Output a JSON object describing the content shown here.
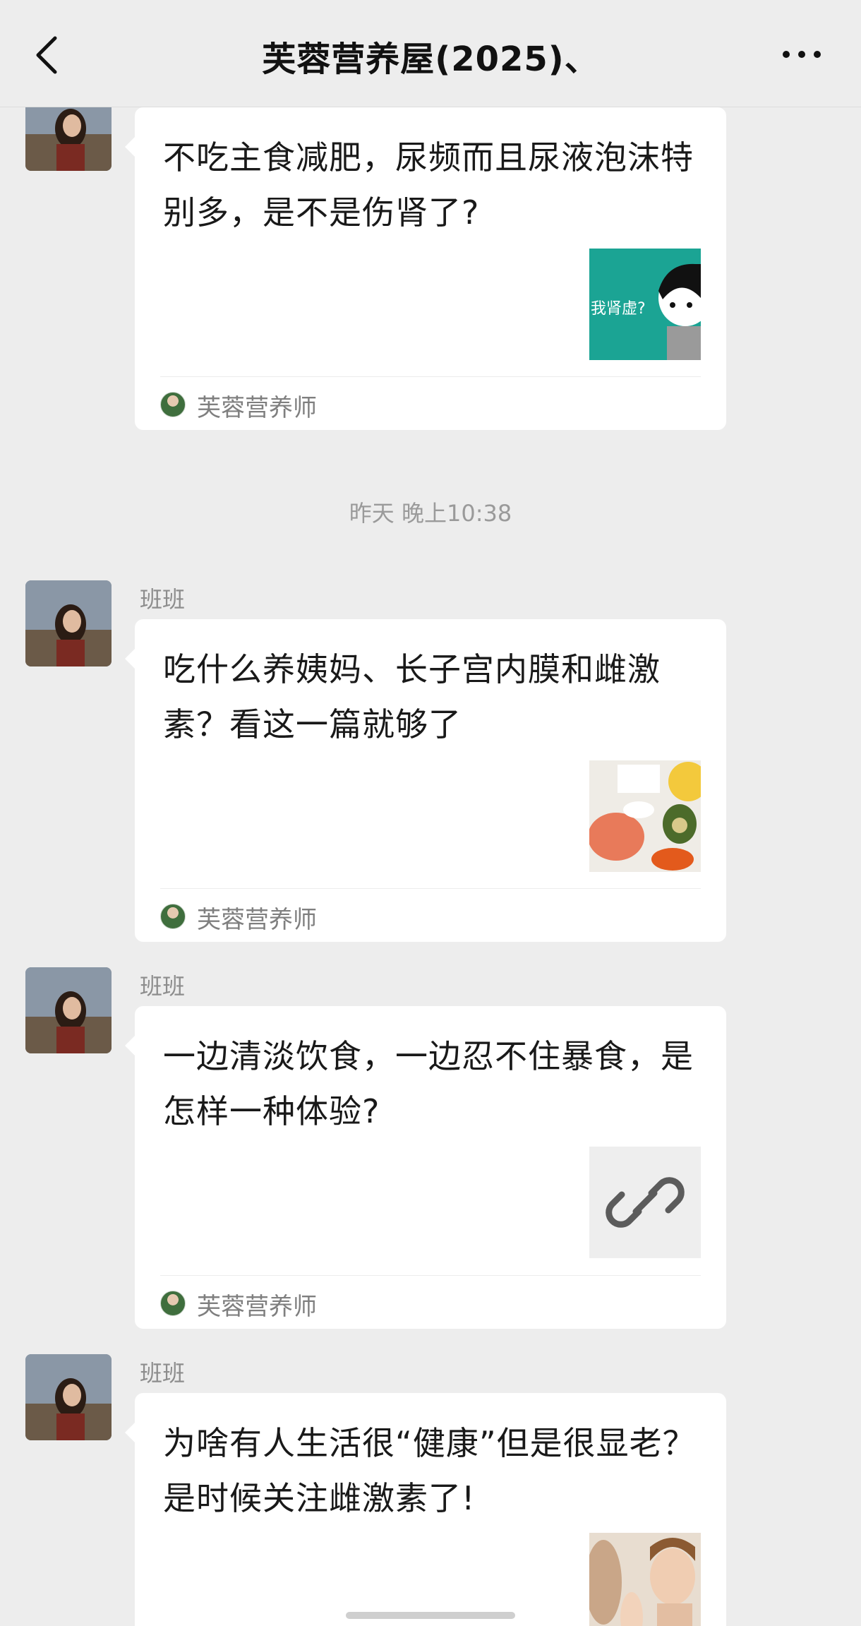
{
  "header": {
    "title": "芙蓉营养屋(2025)、",
    "back_icon": "chevron-left-icon",
    "more_icon": "more-dots-icon"
  },
  "timestamp": "昨天 晚上10:38",
  "messages": [
    {
      "sender": "",
      "title": "不吃主食减肥，尿频而且尿液泡沫特别多，是不是伤肾了?",
      "thumb_text": "我肾虚?",
      "source": "芙蓉营养师"
    },
    {
      "sender": "班班",
      "title": "吃什么养姨妈、长子宫内膜和雌激素？看这一篇就够了",
      "source": "芙蓉营养师"
    },
    {
      "sender": "班班",
      "title": "一边清淡饮食，一边忍不住暴食，是怎样一种体验?",
      "thumb_icon": "link-icon",
      "source": "芙蓉营养师"
    },
    {
      "sender": "班班",
      "title": "为啥有人生活很“健康”但是很显老？是时候关注雌激素了!"
    }
  ],
  "colors": {
    "background": "#ededed",
    "card": "#ffffff",
    "meta_text": "#8d8d8d"
  }
}
